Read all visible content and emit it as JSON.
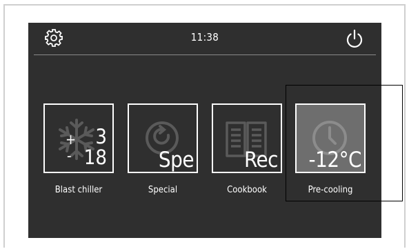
{
  "header": {
    "time": "11:38",
    "settings_icon": "gear-icon",
    "power_icon": "power-icon"
  },
  "tiles": [
    {
      "label": "Blast chiller",
      "icon": "snowflake-icon",
      "plus_sign": "+",
      "minus_sign": "-",
      "upper_value": "3",
      "lower_value": "18",
      "active": false
    },
    {
      "label": "Special",
      "icon": "refresh-cycle-icon",
      "overlay_text": "Spe",
      "active": false
    },
    {
      "label": "Cookbook",
      "icon": "open-book-icon",
      "overlay_text": "Rec",
      "active": false
    },
    {
      "label": "Pre-cooling",
      "icon": "clock-icon",
      "overlay_text": "-12°C",
      "active": true
    }
  ],
  "colors": {
    "screen_bg": "#2f2f2f",
    "active_tile_bg": "#6e6e6e",
    "icon_gray": "#5a5a5a",
    "text": "#ffffff"
  }
}
